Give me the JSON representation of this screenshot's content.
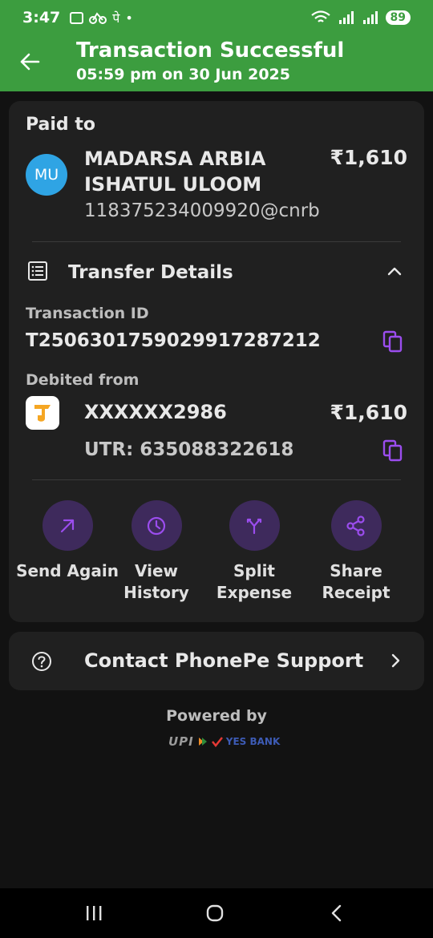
{
  "status_bar": {
    "time": "3:47",
    "carrier_glyph": "पे",
    "battery": "89"
  },
  "header": {
    "title": "Transaction Successful",
    "subtitle": "05:59 pm on 30 Jun 2025"
  },
  "paid_to": {
    "label": "Paid to",
    "avatar_initials": "MU",
    "payee_name": "MADARSA ARBIA ISHATUL ULOOM",
    "amount": "₹1,610",
    "vpa": "118375234009920@cnrb"
  },
  "transfer_details": {
    "title": "Transfer Details",
    "transaction_id_label": "Transaction ID",
    "transaction_id": "T2506301759029917287212",
    "debited_from_label": "Debited from",
    "account": "XXXXXX2986",
    "amount": "₹1,610",
    "utr": "UTR: 635088322618"
  },
  "actions": [
    {
      "label": "Send Again",
      "icon": "arrow-up-right-icon"
    },
    {
      "label": "View History",
      "icon": "clock-icon"
    },
    {
      "label": "Split Expense",
      "icon": "split-icon"
    },
    {
      "label": "Share Receipt",
      "icon": "share-icon"
    }
  ],
  "support": {
    "label": "Contact PhonePe Support"
  },
  "footer": {
    "powered_by": "Powered by",
    "upi_logo_text": "UPI",
    "bank_logo_text": "YES BANK"
  },
  "colors": {
    "header_green": "#3c9d3f",
    "accent_purple": "#9b4dee",
    "action_circle": "#3e2a5c",
    "avatar_blue": "#2fa4e4",
    "card_bg": "#202020",
    "page_bg": "#121212"
  }
}
